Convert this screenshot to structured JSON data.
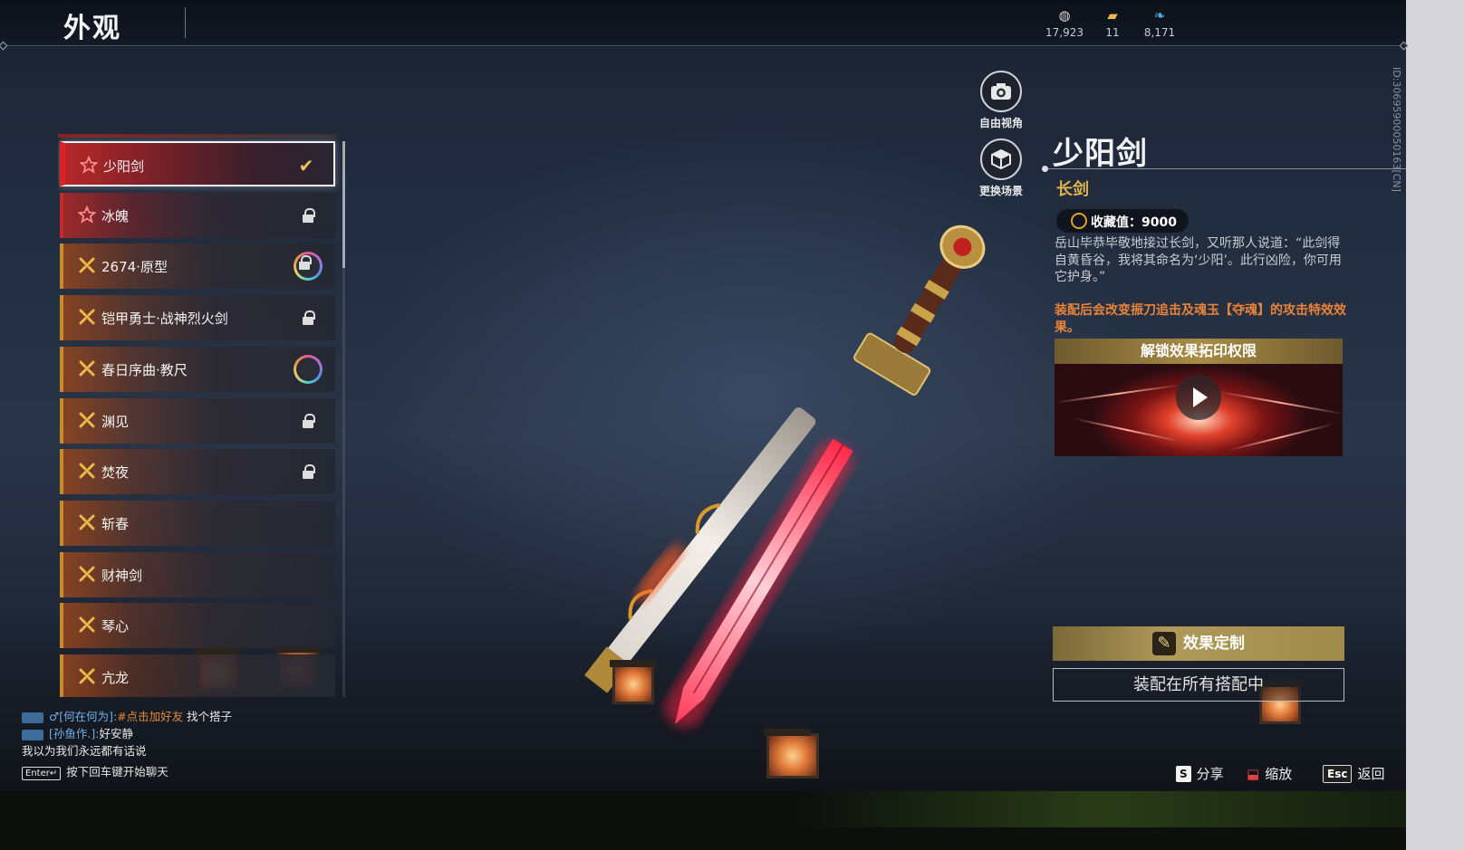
{
  "header": {
    "title": "外观",
    "currencies": [
      {
        "icon": "coin-icon",
        "value": "17,923"
      },
      {
        "icon": "ticket-icon",
        "value": "11"
      },
      {
        "icon": "feather-icon",
        "value": "8,171"
      }
    ]
  },
  "list": {
    "items": [
      {
        "name": "少阳剑",
        "quality": "red",
        "status": "equipped"
      },
      {
        "name": "冰魄",
        "quality": "red",
        "status": "locked"
      },
      {
        "name": "2674·原型",
        "quality": "gold",
        "status": "ring-locked"
      },
      {
        "name": "铠甲勇士·战神烈火剑",
        "quality": "gold",
        "status": "locked"
      },
      {
        "name": "春日序曲·教尺",
        "quality": "gold",
        "status": "ring"
      },
      {
        "name": "渊见",
        "quality": "gold",
        "status": "locked"
      },
      {
        "name": "焚夜",
        "quality": "gold",
        "status": "locked"
      },
      {
        "name": "斩春",
        "quality": "gold",
        "status": "none"
      },
      {
        "name": "财神剑",
        "quality": "gold",
        "status": "none"
      },
      {
        "name": "琴心",
        "quality": "gold",
        "status": "none"
      },
      {
        "name": "亢龙",
        "quality": "gold",
        "status": "none"
      }
    ]
  },
  "viewer": {
    "free_camera_label": "自由视角",
    "change_scene_label": "更换场景"
  },
  "detail": {
    "name": "少阳剑",
    "type": "长剑",
    "collection_value": "收藏值：9000",
    "description": "岳山毕恭毕敬地接过长剑，又听那人说道：“此剑得自黄昏谷，我将其命名为‘少阳’。此行凶险，你可用它护身。”",
    "effect": "装配后会改变振刀追击及魂玉【夺魂】的攻击特效效果。",
    "video_title": "解锁效果拓印权限",
    "customize_label": "效果定制",
    "equip_label": "装配在所有搭配中",
    "side_id": "ID:3069590005016​3[CN]"
  },
  "chat": {
    "lines": [
      {
        "sender": "[何在何为]:",
        "link": "#点击加好友",
        "text": "找个搭子"
      },
      {
        "sender": "[孙鱼作.]:",
        "link": "",
        "text": "好安静"
      },
      {
        "sender": "",
        "link": "",
        "text": "我以为我们永远都有话说"
      }
    ],
    "enter_key": "Enter↵",
    "hint": "按下回车键开始聊天"
  },
  "hotkeys": {
    "share_key": "S",
    "share_label": "分享",
    "zoom_label": "缩放",
    "back_key": "Esc",
    "back_label": "返回"
  },
  "colors": {
    "accent_gold": "#e3b54a",
    "accent_red": "#c52b2b",
    "effect_orange": "#e8833a"
  }
}
